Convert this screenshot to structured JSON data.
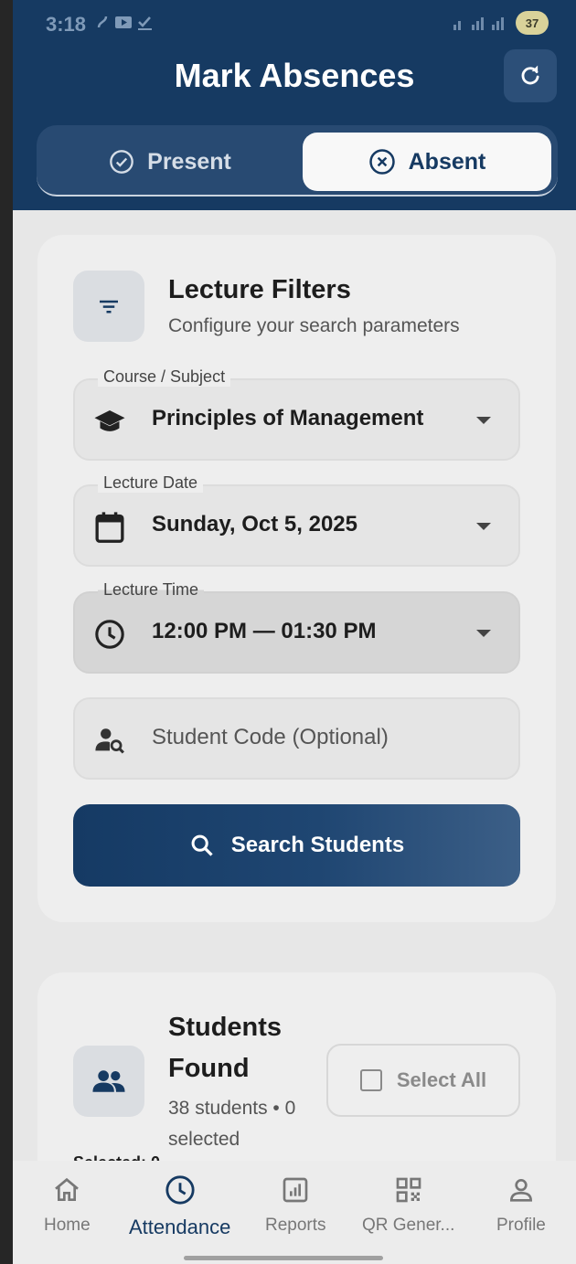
{
  "status_bar": {
    "time": "3:18",
    "battery": "37"
  },
  "header": {
    "title": "Mark Absences",
    "refresh_icon": "refresh-icon"
  },
  "mode_toggle": {
    "present_label": "Present",
    "absent_label": "Absent",
    "selected": "Absent"
  },
  "filters": {
    "title": "Lecture Filters",
    "subtitle": "Configure your search parameters",
    "course": {
      "label": "Course / Subject",
      "value": "Principles of Management"
    },
    "date": {
      "label": "Lecture Date",
      "value": "Sunday, Oct 5, 2025"
    },
    "time": {
      "label": "Lecture Time",
      "value": "12:00 PM — 01:30 PM"
    },
    "student_code": {
      "placeholder": "Student Code (Optional)"
    },
    "search_button": "Search Students"
  },
  "students": {
    "title": "Students Found",
    "meta": "38 students • 0 selected",
    "select_all": "Select All",
    "peek": "Selected: 0"
  },
  "bottom_nav": {
    "items": [
      {
        "label": "Home",
        "icon": "home-icon"
      },
      {
        "label": "Attendance",
        "icon": "clock-icon",
        "active": true
      },
      {
        "label": "Reports",
        "icon": "chart-icon"
      },
      {
        "label": "QR Gener...",
        "icon": "qr-code-icon"
      },
      {
        "label": "Profile",
        "icon": "person-icon"
      }
    ]
  },
  "colors": {
    "primary": "#163a62",
    "background": "#e7e7e7",
    "card": "#eeeeee"
  }
}
